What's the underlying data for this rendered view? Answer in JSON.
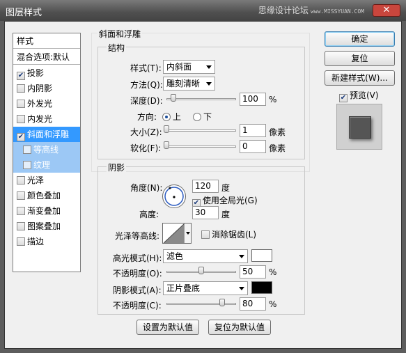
{
  "window": {
    "title": "图层样式",
    "watermark": "思缘设计论坛",
    "watermark_sub": "www.MISSYUAN.COM",
    "close_icon": "close-icon"
  },
  "left_list": {
    "header": "样式",
    "blend_options": "混合选项:默认",
    "items": [
      {
        "label": "投影",
        "checked": true
      },
      {
        "label": "内阴影",
        "checked": false
      },
      {
        "label": "外发光",
        "checked": false
      },
      {
        "label": "内发光",
        "checked": false
      },
      {
        "label": "斜面和浮雕",
        "checked": true
      },
      {
        "label": "等高线",
        "checked": false
      },
      {
        "label": "纹理",
        "checked": false
      },
      {
        "label": "光泽",
        "checked": false
      },
      {
        "label": "颜色叠加",
        "checked": false
      },
      {
        "label": "渐变叠加",
        "checked": false
      },
      {
        "label": "图案叠加",
        "checked": false
      },
      {
        "label": "描边",
        "checked": false
      }
    ]
  },
  "bevel": {
    "group_title": "斜面和浮雕",
    "structure_title": "结构",
    "style_label": "样式(T):",
    "style_value": "内斜面",
    "technique_label": "方法(Q):",
    "technique_value": "雕刻清晰",
    "depth_label": "深度(D):",
    "depth_value": "100",
    "depth_unit": "%",
    "depth_fraction": 0.1,
    "direction_label": "方向:",
    "direction_up": "上",
    "direction_down": "下",
    "size_label": "大小(Z):",
    "size_value": "1",
    "size_unit": "像素",
    "soften_label": "软化(F):",
    "soften_value": "0",
    "soften_unit": "像素"
  },
  "shading": {
    "title": "阴影",
    "angle_label": "角度(N):",
    "angle_value": "120",
    "angle_unit": "度",
    "global_light_label": "使用全局光(G)",
    "global_light_checked": true,
    "altitude_label": "高度:",
    "altitude_value": "30",
    "altitude_unit": "度",
    "gloss_contour_label": "光泽等高线:",
    "antialias_label": "消除锯齿(L)",
    "antialias_checked": false,
    "highlight_mode_label": "高光模式(H):",
    "highlight_mode_value": "滤色",
    "highlight_color": "#ffffff",
    "highlight_opacity_label": "不透明度(O):",
    "highlight_opacity_value": "50",
    "highlight_opacity_fraction": 0.5,
    "shadow_mode_label": "阴影模式(A):",
    "shadow_mode_value": "正片叠底",
    "shadow_color": "#000000",
    "shadow_opacity_label": "不透明度(C):",
    "shadow_opacity_value": "80",
    "shadow_opacity_fraction": 0.8,
    "percent_unit": "%"
  },
  "buttons": {
    "make_default": "设置为默认值",
    "reset_default": "复位为默认值",
    "ok": "确定",
    "reset": "复位",
    "new_style": "新建样式(W)...",
    "preview_label": "预览(V)",
    "preview_checked": true
  },
  "colors": {
    "selection": "#3399ff",
    "sub_selection": "#9cc8f5"
  }
}
